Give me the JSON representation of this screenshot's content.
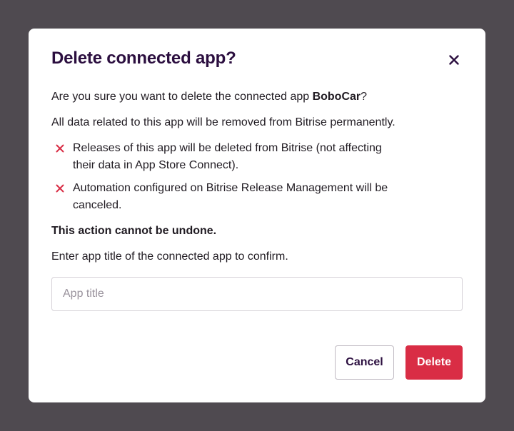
{
  "dialog": {
    "title": "Delete connected app?",
    "close_icon": "close-icon",
    "confirm_prefix": "Are you sure you want to delete the connected app ",
    "app_name": "BoboCar",
    "confirm_suffix": "?",
    "removal_notice": "All data related to this app will be removed from Bitrise permanently.",
    "consequences": [
      {
        "icon": "x-icon",
        "text": "Releases of this app will be deleted from Bitrise (not affecting their data in App Store Connect)."
      },
      {
        "icon": "x-icon",
        "text": "Automation configured on Bitrise Release Management will be canceled."
      }
    ],
    "warning": "This action cannot be undone.",
    "instruction": "Enter app title of the connected app to confirm.",
    "input": {
      "placeholder": "App title",
      "value": ""
    },
    "cancel_label": "Cancel",
    "delete_label": "Delete"
  },
  "colors": {
    "backdrop": "#4f4a50",
    "title": "#2b0e3f",
    "danger": "#d92d45",
    "x_icon": "#d92d45"
  }
}
